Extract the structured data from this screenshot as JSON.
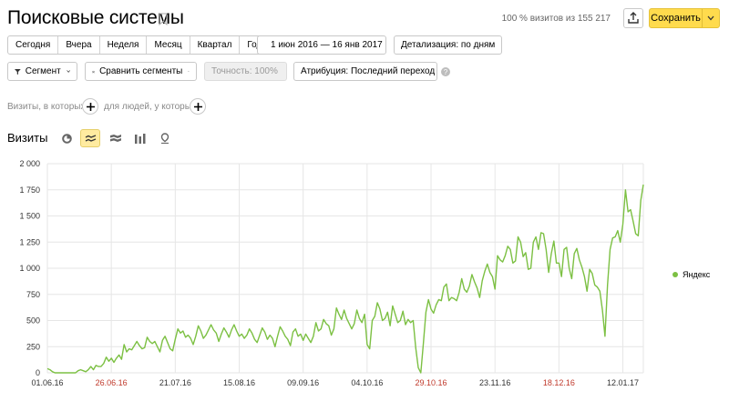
{
  "header": {
    "title": "Поисковые системы",
    "visits_info": "100 % визитов из 155 217",
    "save_label": "Сохранить"
  },
  "period_tabs": [
    "Сегодня",
    "Вчера",
    "Неделя",
    "Месяц",
    "Квартал",
    "Год"
  ],
  "date_range": "1 июн 2016 — 16 янв 2017",
  "detail": "Детализация: по дням",
  "toolbar2": {
    "segment": "Сегмент",
    "compare": "Сравнить сегменты",
    "accuracy": "Точность: 100%",
    "attribution": "Атрибуция: Последний переход"
  },
  "filters": {
    "visits_where": "Визиты, в которых",
    "people_where": "для людей, у которых"
  },
  "chart_section": {
    "label": "Визиты",
    "types": [
      "pie-chart-icon",
      "line-chart-icon",
      "area-chart-icon",
      "bar-chart-icon",
      "map-icon"
    ],
    "active_type": "line-chart-icon"
  },
  "colors": {
    "series": "#7cc043",
    "accent": "#ffdb4d",
    "weekend_tick": "#c0392b"
  },
  "chart_data": {
    "type": "line",
    "x_start": "01.06.16",
    "x_end": "16.01.17",
    "x_ticks": [
      {
        "label": "01.06.16",
        "day": 0,
        "weekend": false
      },
      {
        "label": "26.06.16",
        "day": 25,
        "weekend": true
      },
      {
        "label": "21.07.16",
        "day": 50,
        "weekend": false
      },
      {
        "label": "15.08.16",
        "day": 75,
        "weekend": false
      },
      {
        "label": "09.09.16",
        "day": 100,
        "weekend": false
      },
      {
        "label": "04.10.16",
        "day": 125,
        "weekend": false
      },
      {
        "label": "29.10.16",
        "day": 150,
        "weekend": true
      },
      {
        "label": "23.11.16",
        "day": 175,
        "weekend": false
      },
      {
        "label": "18.12.16",
        "day": 200,
        "weekend": true
      },
      {
        "label": "12.01.17",
        "day": 225,
        "weekend": false
      }
    ],
    "y_ticks": [
      "0",
      "250",
      "500",
      "750",
      "1 000",
      "1 250",
      "1 500",
      "1 750",
      "2 000"
    ],
    "ylim": [
      0,
      2000
    ],
    "grid": true,
    "legend_position": "right",
    "series": [
      {
        "name": "Яндекс",
        "points": [
          [
            0,
            40
          ],
          [
            1,
            30
          ],
          [
            2,
            10
          ],
          [
            3,
            0
          ],
          [
            4,
            0
          ],
          [
            5,
            0
          ],
          [
            7,
            0
          ],
          [
            9,
            0
          ],
          [
            11,
            0
          ],
          [
            12,
            20
          ],
          [
            13,
            30
          ],
          [
            14,
            20
          ],
          [
            15,
            10
          ],
          [
            16,
            30
          ],
          [
            17,
            60
          ],
          [
            18,
            30
          ],
          [
            19,
            70
          ],
          [
            20,
            60
          ],
          [
            21,
            60
          ],
          [
            22,
            90
          ],
          [
            23,
            150
          ],
          [
            24,
            110
          ],
          [
            25,
            140
          ],
          [
            26,
            100
          ],
          [
            27,
            140
          ],
          [
            28,
            170
          ],
          [
            29,
            130
          ],
          [
            30,
            270
          ],
          [
            31,
            200
          ],
          [
            32,
            230
          ],
          [
            33,
            220
          ],
          [
            34,
            260
          ],
          [
            35,
            300
          ],
          [
            36,
            260
          ],
          [
            37,
            230
          ],
          [
            38,
            240
          ],
          [
            39,
            340
          ],
          [
            40,
            300
          ],
          [
            41,
            280
          ],
          [
            42,
            300
          ],
          [
            43,
            250
          ],
          [
            44,
            200
          ],
          [
            45,
            310
          ],
          [
            46,
            350
          ],
          [
            47,
            290
          ],
          [
            48,
            230
          ],
          [
            49,
            210
          ],
          [
            50,
            320
          ],
          [
            51,
            420
          ],
          [
            52,
            380
          ],
          [
            53,
            400
          ],
          [
            54,
            340
          ],
          [
            55,
            360
          ],
          [
            56,
            330
          ],
          [
            57,
            270
          ],
          [
            58,
            350
          ],
          [
            59,
            450
          ],
          [
            60,
            400
          ],
          [
            61,
            330
          ],
          [
            62,
            360
          ],
          [
            63,
            410
          ],
          [
            64,
            460
          ],
          [
            65,
            410
          ],
          [
            66,
            380
          ],
          [
            67,
            300
          ],
          [
            68,
            370
          ],
          [
            69,
            430
          ],
          [
            70,
            390
          ],
          [
            71,
            340
          ],
          [
            72,
            410
          ],
          [
            73,
            460
          ],
          [
            74,
            400
          ],
          [
            75,
            350
          ],
          [
            76,
            370
          ],
          [
            77,
            330
          ],
          [
            78,
            360
          ],
          [
            79,
            420
          ],
          [
            80,
            380
          ],
          [
            81,
            320
          ],
          [
            82,
            290
          ],
          [
            83,
            360
          ],
          [
            84,
            430
          ],
          [
            85,
            390
          ],
          [
            86,
            320
          ],
          [
            87,
            360
          ],
          [
            88,
            330
          ],
          [
            89,
            250
          ],
          [
            90,
            350
          ],
          [
            91,
            440
          ],
          [
            92,
            400
          ],
          [
            93,
            350
          ],
          [
            94,
            320
          ],
          [
            95,
            260
          ],
          [
            96,
            390
          ],
          [
            97,
            420
          ],
          [
            98,
            350
          ],
          [
            99,
            370
          ],
          [
            100,
            310
          ],
          [
            101,
            370
          ],
          [
            102,
            330
          ],
          [
            103,
            290
          ],
          [
            104,
            350
          ],
          [
            105,
            480
          ],
          [
            106,
            400
          ],
          [
            107,
            420
          ],
          [
            108,
            510
          ],
          [
            109,
            470
          ],
          [
            110,
            450
          ],
          [
            111,
            360
          ],
          [
            112,
            420
          ],
          [
            113,
            620
          ],
          [
            114,
            560
          ],
          [
            115,
            510
          ],
          [
            116,
            600
          ],
          [
            117,
            520
          ],
          [
            118,
            470
          ],
          [
            119,
            420
          ],
          [
            120,
            470
          ],
          [
            121,
            600
          ],
          [
            122,
            520
          ],
          [
            123,
            480
          ],
          [
            124,
            560
          ],
          [
            125,
            270
          ],
          [
            126,
            230
          ],
          [
            127,
            500
          ],
          [
            128,
            540
          ],
          [
            129,
            670
          ],
          [
            130,
            610
          ],
          [
            131,
            500
          ],
          [
            132,
            520
          ],
          [
            133,
            580
          ],
          [
            134,
            450
          ],
          [
            135,
            640
          ],
          [
            136,
            560
          ],
          [
            137,
            480
          ],
          [
            138,
            500
          ],
          [
            139,
            590
          ],
          [
            140,
            460
          ],
          [
            141,
            510
          ],
          [
            142,
            480
          ],
          [
            143,
            500
          ],
          [
            144,
            240
          ],
          [
            145,
            50
          ],
          [
            146,
            0
          ],
          [
            147,
            280
          ],
          [
            148,
            580
          ],
          [
            149,
            700
          ],
          [
            150,
            610
          ],
          [
            151,
            570
          ],
          [
            152,
            650
          ],
          [
            153,
            700
          ],
          [
            154,
            690
          ],
          [
            155,
            820
          ],
          [
            156,
            850
          ],
          [
            157,
            690
          ],
          [
            158,
            720
          ],
          [
            159,
            710
          ],
          [
            160,
            690
          ],
          [
            161,
            770
          ],
          [
            162,
            900
          ],
          [
            163,
            800
          ],
          [
            164,
            770
          ],
          [
            165,
            830
          ],
          [
            166,
            940
          ],
          [
            167,
            870
          ],
          [
            168,
            810
          ],
          [
            169,
            720
          ],
          [
            170,
            880
          ],
          [
            171,
            970
          ],
          [
            172,
            1040
          ],
          [
            173,
            960
          ],
          [
            174,
            920
          ],
          [
            175,
            800
          ],
          [
            176,
            1120
          ],
          [
            177,
            1080
          ],
          [
            178,
            1060
          ],
          [
            179,
            1120
          ],
          [
            180,
            1210
          ],
          [
            181,
            1180
          ],
          [
            182,
            1050
          ],
          [
            183,
            1070
          ],
          [
            184,
            1300
          ],
          [
            185,
            1250
          ],
          [
            186,
            1110
          ],
          [
            187,
            1150
          ],
          [
            188,
            990
          ],
          [
            189,
            1000
          ],
          [
            190,
            1250
          ],
          [
            191,
            1300
          ],
          [
            192,
            1180
          ],
          [
            193,
            1340
          ],
          [
            194,
            1330
          ],
          [
            195,
            1180
          ],
          [
            196,
            960
          ],
          [
            197,
            1140
          ],
          [
            198,
            1260
          ],
          [
            199,
            1050
          ],
          [
            200,
            1050
          ],
          [
            201,
            920
          ],
          [
            202,
            1180
          ],
          [
            203,
            1200
          ],
          [
            204,
            1000
          ],
          [
            205,
            900
          ],
          [
            206,
            1140
          ],
          [
            207,
            1190
          ],
          [
            208,
            1080
          ],
          [
            209,
            1010
          ],
          [
            210,
            920
          ],
          [
            211,
            780
          ],
          [
            212,
            990
          ],
          [
            213,
            950
          ],
          [
            214,
            840
          ],
          [
            215,
            820
          ],
          [
            216,
            780
          ],
          [
            217,
            600
          ],
          [
            218,
            350
          ],
          [
            219,
            840
          ],
          [
            220,
            1180
          ],
          [
            221,
            1290
          ],
          [
            222,
            1300
          ],
          [
            223,
            1360
          ],
          [
            224,
            1250
          ],
          [
            225,
            1420
          ],
          [
            226,
            1750
          ],
          [
            227,
            1540
          ],
          [
            228,
            1560
          ],
          [
            229,
            1450
          ],
          [
            230,
            1330
          ],
          [
            231,
            1310
          ],
          [
            232,
            1650
          ],
          [
            233,
            1800
          ]
        ]
      }
    ]
  }
}
